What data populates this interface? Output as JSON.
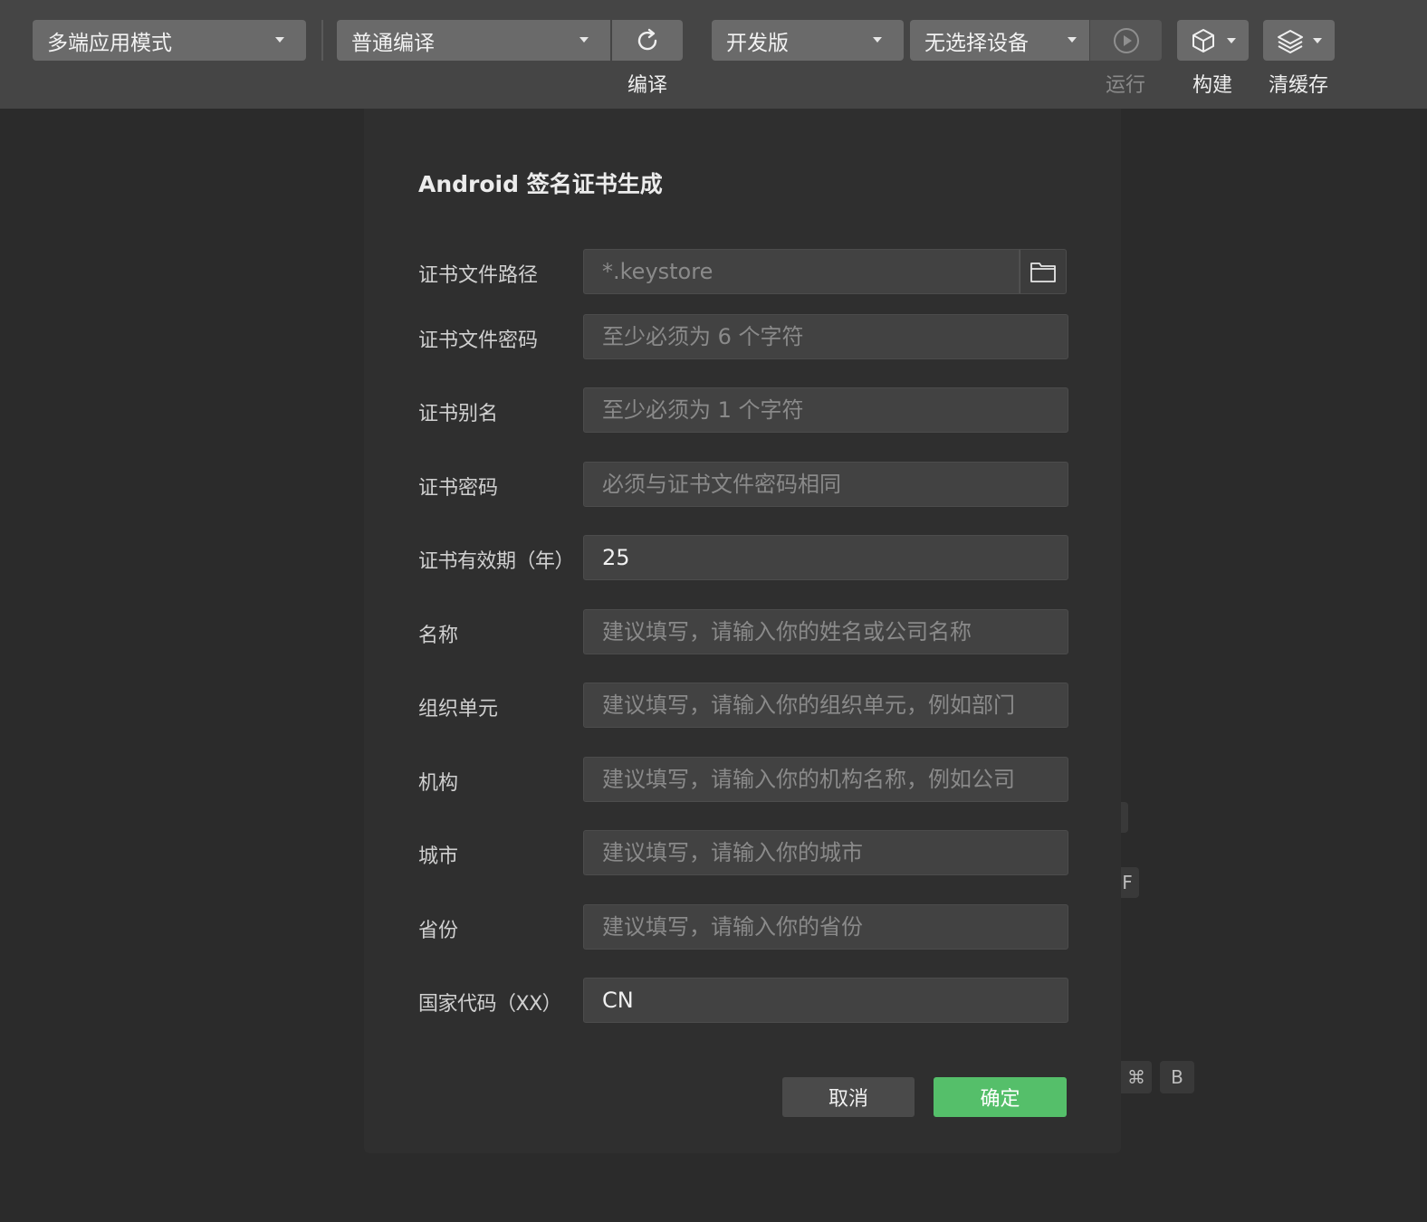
{
  "toolbar": {
    "mode_select": "多端应用模式",
    "compile_select": "普通编译",
    "compile_label": "编译",
    "version_select": "开发版",
    "device_select": "无选择设备",
    "run_label": "运行",
    "build_label": "构建",
    "clear_cache_label": "清缓存"
  },
  "background_hints": {
    "key_f": "F",
    "key_cmd": "⌘",
    "key_b": "B"
  },
  "dialog": {
    "title": "Android 签名证书生成",
    "fields": {
      "keystore_path": {
        "label": "证书文件路径",
        "value": "",
        "placeholder": "*.keystore"
      },
      "keystore_pass": {
        "label": "证书文件密码",
        "value": "",
        "placeholder": "至少必须为 6 个字符"
      },
      "alias": {
        "label": "证书别名",
        "value": "",
        "placeholder": "至少必须为 1 个字符"
      },
      "alias_pass": {
        "label": "证书密码",
        "value": "",
        "placeholder": "必须与证书文件密码相同"
      },
      "validity": {
        "label": "证书有效期（年）",
        "value": "25",
        "placeholder": ""
      },
      "name": {
        "label": "名称",
        "value": "",
        "placeholder": "建议填写，请输入你的姓名或公司名称"
      },
      "org_unit": {
        "label": "组织单元",
        "value": "",
        "placeholder": "建议填写，请输入你的组织单元，例如部门"
      },
      "organization": {
        "label": "机构",
        "value": "",
        "placeholder": "建议填写，请输入你的机构名称，例如公司"
      },
      "city": {
        "label": "城市",
        "value": "",
        "placeholder": "建议填写，请输入你的城市"
      },
      "province": {
        "label": "省份",
        "value": "",
        "placeholder": "建议填写，请输入你的省份"
      },
      "country": {
        "label": "国家代码（XX）",
        "value": "CN",
        "placeholder": ""
      }
    },
    "cancel_label": "取消",
    "ok_label": "确定"
  },
  "colors": {
    "accent_green": "#55bf6a",
    "toolbar_bg": "#454545",
    "dialog_bg": "#2f2f2f"
  },
  "icons": {
    "refresh": "refresh-icon",
    "play": "play-icon",
    "build": "cube-icon",
    "clear_cache": "layers-icon",
    "folder": "folder-icon"
  }
}
